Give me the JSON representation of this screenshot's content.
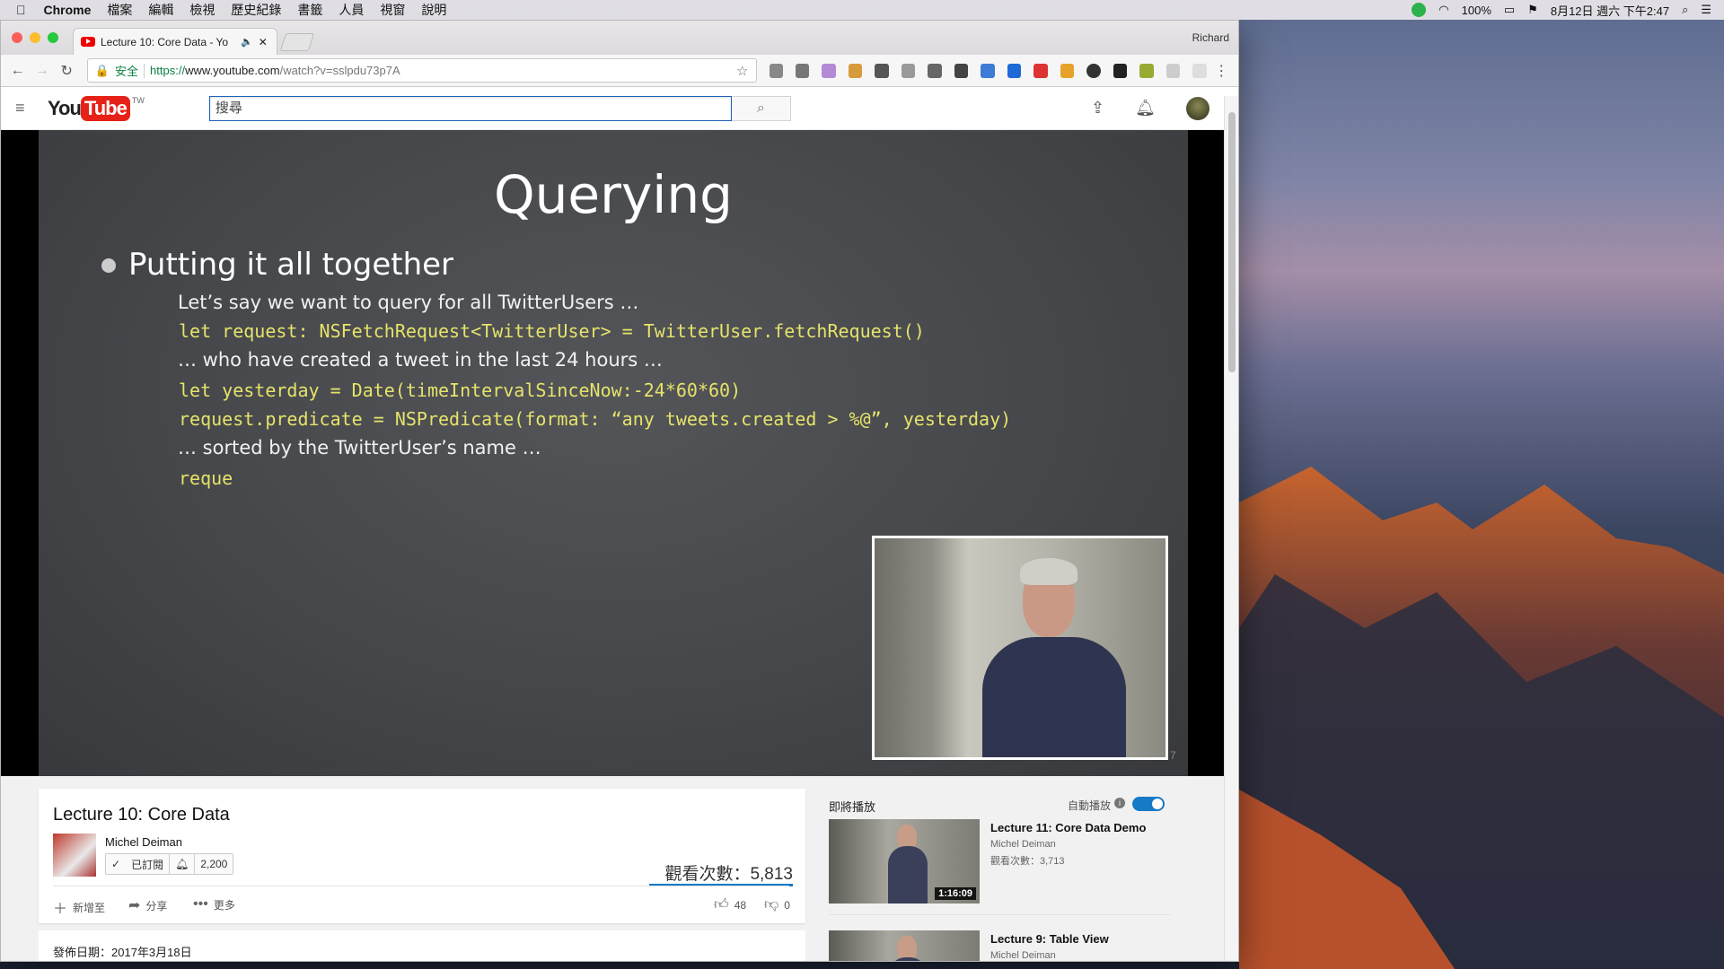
{
  "menubar": {
    "app": "Chrome",
    "items": [
      "檔案",
      "編輯",
      "檢視",
      "歷史紀錄",
      "書籤",
      "人員",
      "視窗",
      "說明"
    ],
    "battery": "100%",
    "datetime": "8月12日 週六 下午2:47"
  },
  "browser": {
    "tab_title": "Lecture 10: Core Data - Yo",
    "profile": "Richard",
    "secure_label": "安全",
    "url_scheme": "https://",
    "url_host": "www.youtube.com",
    "url_path": "/watch?v=sslpdu73p7A"
  },
  "youtube": {
    "logo_you": "You",
    "logo_tube": "Tube",
    "logo_region": "TW",
    "search_placeholder": "搜尋"
  },
  "slide": {
    "title": "Querying",
    "bullet": "Putting it all together",
    "lines": [
      "Let’s say we want to query for all TwitterUsers …",
      "let request: NSFetchRequest<TwitterUser> = TwitterUser.fetchRequest()",
      "… who have created a tweet in the last 24 hours …",
      "let yesterday = Date(timeIntervalSinceNow:-24*60*60)",
      "request.predicate = NSPredicate(format: “any tweets.created > %@”, yesterday)",
      "… sorted by the TwitterUser’s name …",
      "reque"
    ],
    "slide_number": "7"
  },
  "video": {
    "title": "Lecture 10: Core Data",
    "channel": "Michel Deiman",
    "subscribed_label": "已訂閱",
    "subscriber_count": "2,200",
    "views": "觀看次數：5,813",
    "add_to": "新增至",
    "share": "分享",
    "more": "更多",
    "likes": "48",
    "dislikes": "0",
    "published": "發佈日期：2017年3月18日"
  },
  "sidebar": {
    "up_next": "即將播放",
    "autoplay": "自動播放",
    "items": [
      {
        "title": "Lecture 11: Core Data Demo",
        "channel": "Michel Deiman",
        "views": "觀看次數：3,713",
        "duration": "1:16:09"
      },
      {
        "title": "Lecture 9: Table View",
        "channel": "Michel Deiman"
      }
    ]
  }
}
